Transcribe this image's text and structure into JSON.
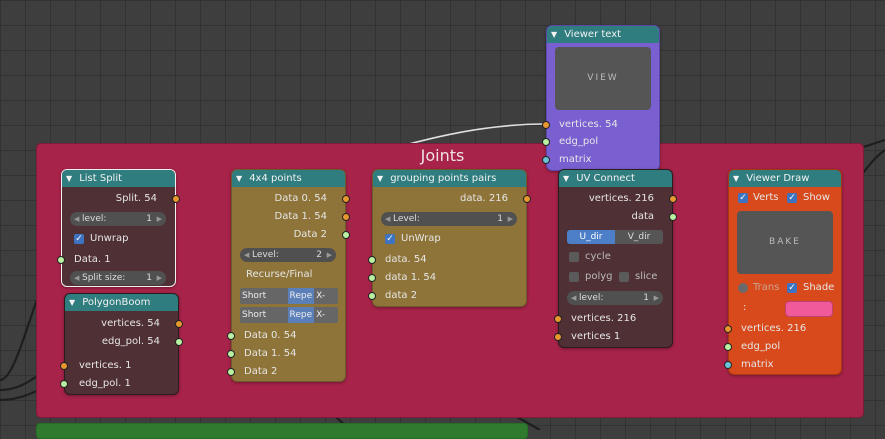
{
  "frame": {
    "title": "Joints"
  },
  "viewer_text": {
    "title": "Viewer text",
    "preview": "VIEW",
    "inputs": [
      "vertices. 54",
      "edg_pol",
      "matrix"
    ]
  },
  "list_split": {
    "title": "List Split",
    "output": "Split. 54",
    "level_label": "level:",
    "level_value": "1",
    "unwrap_label": "Unwrap",
    "input": "Data. 1",
    "split_size_label": "Split size:",
    "split_size_value": "1"
  },
  "polygon_boom": {
    "title": "PolygonBoom",
    "outputs": [
      "vertices. 54",
      "edg_pol. 54"
    ],
    "inputs": [
      "vertices. 1",
      "edg_pol. 1"
    ]
  },
  "points_4x4": {
    "title": "4x4 points",
    "outputs": [
      "Data 0. 54",
      "Data 1. 54",
      "Data 2"
    ],
    "level_label": "Level:",
    "level_value": "2",
    "recurse_label": "Recurse/Final",
    "cycle_rows": [
      {
        "a": "Short Cycle",
        "b": "Repe",
        "c": "X-Ref"
      },
      {
        "a": "Short Cycle",
        "b": "Repe",
        "c": "X-Ref"
      }
    ],
    "inputs": [
      "Data 0. 54",
      "Data 1. 54",
      "Data 2"
    ]
  },
  "grouping": {
    "title": "grouping points pairs",
    "output": "data. 216",
    "level_label": "Level:",
    "level_value": "1",
    "unwrap_label": "UnWrap",
    "inputs": [
      "data. 54",
      "data 1. 54",
      "data 2"
    ]
  },
  "uv_connect": {
    "title": "UV Connect",
    "outputs": [
      "vertices. 216",
      "data"
    ],
    "dir_buttons": [
      "U_dir",
      "V_dir"
    ],
    "cycle_label": "cycle",
    "polyg_label": "polyg",
    "slice_label": "slice",
    "level_label": "level:",
    "level_value": "1",
    "inputs": [
      "vertices. 216",
      "vertices 1"
    ]
  },
  "viewer_draw": {
    "title": "Viewer Draw",
    "verts_label": "Verts",
    "show_label": "Show",
    "preview": "BAKE",
    "trans_label": "Trans",
    "shade_label": "Shade",
    "color_label": ":",
    "inputs": [
      "vertices. 216",
      "edg_pol",
      "matrix"
    ],
    "shade_color": "#f15a9a"
  },
  "colors": {
    "frame": "#a8234a",
    "header": "#2f7d7f",
    "viewer_text_body": "#7a5fd0",
    "points_body": "#8e7438",
    "viewer_draw_body": "#d84a1c",
    "socket_vertices": "#e8962f",
    "socket_data": "#b9f0a2",
    "socket_matrix": "#6ac3d6"
  }
}
